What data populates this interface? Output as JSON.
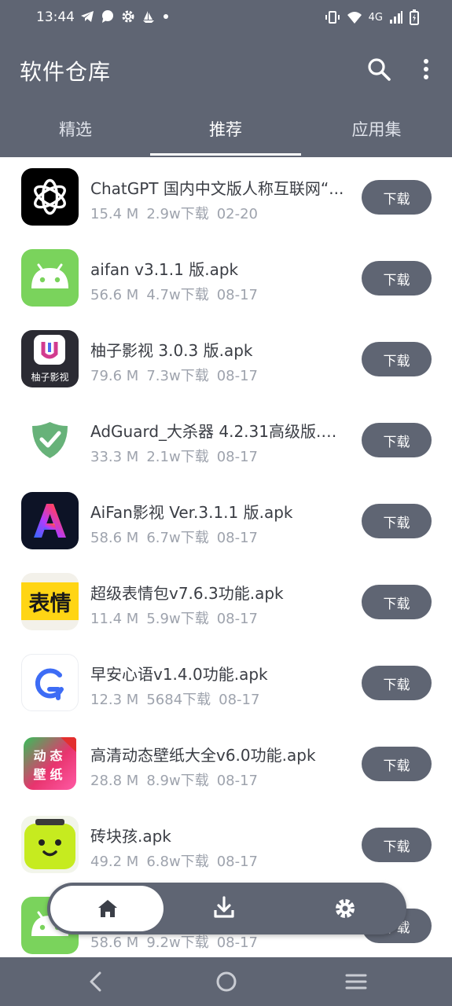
{
  "status_bar": {
    "time": "13:44",
    "network": "4G"
  },
  "app": {
    "title": "软件仓库"
  },
  "tabs": [
    {
      "label": "精选",
      "active": false
    },
    {
      "label": "推荐",
      "active": true
    },
    {
      "label": "应用集",
      "active": false
    }
  ],
  "items": [
    {
      "icon": "chatgpt-icon",
      "name": "ChatGPT 国内中文版人称互联网“...",
      "size": "15.4 M",
      "downloads": "2.9w下载",
      "date": "02-20",
      "button": "下载"
    },
    {
      "icon": "android-icon",
      "name": "aifan v3.1.1 版.apk",
      "size": "56.6 M",
      "downloads": "4.7w下载",
      "date": "08-17",
      "button": "下载"
    },
    {
      "icon": "youzi-icon",
      "icon_text": "柚子影视",
      "name": "柚子影视 3.0.3 版.apk",
      "size": "79.6 M",
      "downloads": "7.3w下载",
      "date": "08-17",
      "button": "下载"
    },
    {
      "icon": "adguard-shield-icon",
      "name": "AdGuard_大杀器 4.2.31高级版.apk",
      "size": "33.3 M",
      "downloads": "2.1w下载",
      "date": "08-17",
      "button": "下载"
    },
    {
      "icon": "aifan-a-icon",
      "name": "AiFan影视 Ver.3.1.1 版.apk",
      "size": "58.6 M",
      "downloads": "6.7w下载",
      "date": "08-17",
      "button": "下载"
    },
    {
      "icon": "emoji-pack-icon",
      "icon_text": "表情",
      "name": "超级表情包v7.6.3功能.apk",
      "size": "11.4 M",
      "downloads": "5.9w下载",
      "date": "08-17",
      "button": "下载"
    },
    {
      "icon": "refresh-q-icon",
      "name": "早安心语v1.4.0功能.apk",
      "size": "12.3 M",
      "downloads": "5684下载",
      "date": "08-17",
      "button": "下载"
    },
    {
      "icon": "wallpaper-icon",
      "icon_text": "动态壁纸",
      "name": "高清动态壁纸大全v6.0功能.apk",
      "size": "28.8 M",
      "downloads": "8.9w下载",
      "date": "08-17",
      "button": "下载"
    },
    {
      "icon": "smiley-block-icon",
      "name": "砖块孩.apk",
      "size": "49.2 M",
      "downloads": "6.8w下载",
      "date": "08-17",
      "button": "下载"
    },
    {
      "icon": "android-icon",
      "name": "",
      "size": "58.6 M",
      "downloads": "9.2w下载",
      "date": "08-17",
      "button": "下载"
    }
  ],
  "bottom_nav": [
    {
      "icon": "home-icon",
      "active": true
    },
    {
      "icon": "download-icon",
      "active": false
    },
    {
      "icon": "settings-icon",
      "active": false
    }
  ],
  "colors": {
    "primary": "#5f6573",
    "background": "#ffffff",
    "meta_text": "#9ea3ad"
  }
}
